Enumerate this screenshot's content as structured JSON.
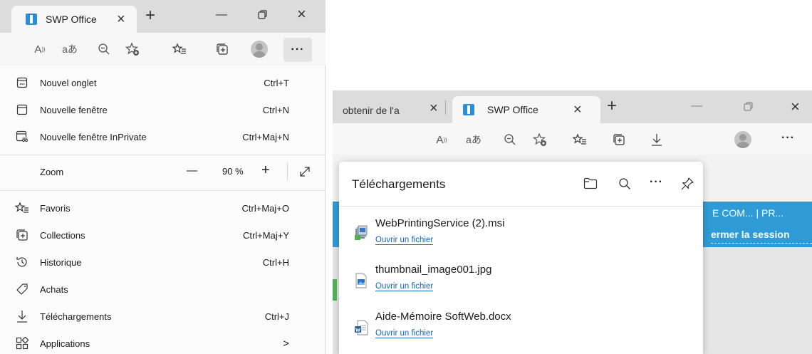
{
  "left_window": {
    "tab": {
      "title": "SWP Office",
      "close": "×"
    },
    "new_tab": "+",
    "window_controls": {
      "minimize": "—",
      "restore": "⧉",
      "close": "×"
    },
    "toolbar": {
      "icons": [
        "read-aloud-icon",
        "translate-icon",
        "zoom-out-icon",
        "add-favorite-icon",
        "favorites-icon",
        "collections-icon",
        "profile-avatar"
      ],
      "read_aloud": "A",
      "translate": "aあ",
      "more": "···"
    },
    "menu": {
      "items": [
        {
          "label": "Nouvel onglet",
          "shortcut": "Ctrl+T",
          "icon": "new-tab-icon"
        },
        {
          "label": "Nouvelle fenêtre",
          "shortcut": "Ctrl+N",
          "icon": "new-window-icon"
        },
        {
          "label": "Nouvelle fenêtre InPrivate",
          "shortcut": "Ctrl+Maj+N",
          "icon": "inprivate-icon"
        }
      ],
      "zoom": {
        "label": "Zoom",
        "minus": "—",
        "value": "90 %",
        "plus": "+"
      },
      "items2": [
        {
          "label": "Favoris",
          "shortcut": "Ctrl+Maj+O",
          "icon": "favorites-icon"
        },
        {
          "label": "Collections",
          "shortcut": "Ctrl+Maj+Y",
          "icon": "collections-icon"
        },
        {
          "label": "Historique",
          "shortcut": "Ctrl+H",
          "icon": "history-icon"
        },
        {
          "label": "Achats",
          "shortcut": "",
          "icon": "shopping-tag-icon"
        },
        {
          "label": "Téléchargements",
          "shortcut": "Ctrl+J",
          "icon": "download-icon"
        },
        {
          "label": "Applications",
          "shortcut": ">",
          "icon": "apps-icon"
        }
      ]
    }
  },
  "right_window": {
    "tabs": [
      {
        "title": "obtenir de l'a",
        "close": "×"
      },
      {
        "title": "SWP Office",
        "close": "×"
      }
    ],
    "new_tab": "+",
    "window_controls": {
      "minimize": "—",
      "restore": "⧉",
      "close": "×"
    },
    "toolbar": {
      "read_aloud": "A",
      "translate": "aあ",
      "more": "···"
    },
    "page": {
      "banner_line1": "E COM... | PR...",
      "banner_line2": "ermer la session"
    },
    "downloads": {
      "title": "Téléchargements",
      "files": [
        {
          "name": "WebPrintingService (2).msi",
          "action": "Ouvrir un fichier",
          "icon": "msi-installer-icon"
        },
        {
          "name": "thumbnail_image001.jpg",
          "action": "Ouvrir un fichier",
          "icon": "image-file-icon"
        },
        {
          "name": "Aide-Mémoire SoftWeb.docx",
          "action": "Ouvrir un fichier",
          "icon": "word-document-icon"
        }
      ]
    }
  }
}
